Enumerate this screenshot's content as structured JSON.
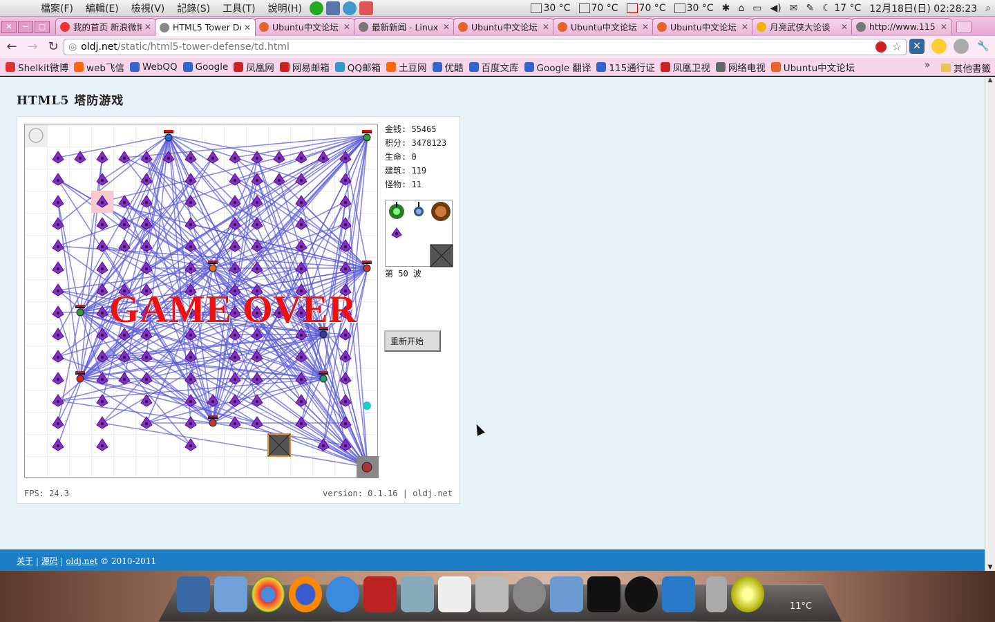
{
  "menubar": {
    "menus": [
      "檔案(F)",
      "編輯(E)",
      "檢視(V)",
      "記錄(S)",
      "工具(T)",
      "說明(H)"
    ],
    "status": {
      "temp1": "30 °C",
      "temp2": "70 °C",
      "temp3": "70 °C",
      "temp4": "30 °C",
      "weather": "17 °C",
      "clock": "12月18日(日) 02:28:23"
    }
  },
  "browser": {
    "tabs": [
      {
        "title": "我的首页 新浪微博",
        "active": false,
        "color": "#e33"
      },
      {
        "title": "HTML5 Tower De",
        "active": true,
        "color": "#888"
      },
      {
        "title": "Ubuntu中文论坛",
        "active": false,
        "color": "#e8622c"
      },
      {
        "title": "最新新闻 - Linux",
        "active": false,
        "color": "#777"
      },
      {
        "title": "Ubuntu中文论坛",
        "active": false,
        "color": "#e8622c"
      },
      {
        "title": "Ubuntu中文论坛",
        "active": false,
        "color": "#e8622c"
      },
      {
        "title": "Ubuntu中文论坛",
        "active": false,
        "color": "#e8622c"
      },
      {
        "title": "月亮武侠大论谈",
        "active": false,
        "color": "#f0b400"
      },
      {
        "title": "http://www.115",
        "active": false,
        "color": "#777"
      }
    ],
    "url_host": "oldj.net",
    "url_path": "/static/html5-tower-defense/td.html",
    "bookmarks": [
      {
        "label": "Shelkit微博",
        "color": "#d33"
      },
      {
        "label": "web飞信",
        "color": "#f60"
      },
      {
        "label": "WebQQ",
        "color": "#36c"
      },
      {
        "label": "Google",
        "color": "#36c"
      },
      {
        "label": "凤凰网",
        "color": "#c22"
      },
      {
        "label": "网易邮箱",
        "color": "#c22"
      },
      {
        "label": "QQ邮箱",
        "color": "#39c"
      },
      {
        "label": "土豆网",
        "color": "#f60"
      },
      {
        "label": "优酷",
        "color": "#36c"
      },
      {
        "label": "百度文库",
        "color": "#36c"
      },
      {
        "label": "Google 翻译",
        "color": "#36c"
      },
      {
        "label": "115通行证",
        "color": "#36c"
      },
      {
        "label": "凤凰卫视",
        "color": "#c22"
      },
      {
        "label": "网络电视",
        "color": "#666"
      },
      {
        "label": "Ubuntu中文论坛",
        "color": "#e8622c"
      }
    ],
    "other_bookmarks": "其他書籤"
  },
  "page": {
    "title": "HTML5 塔防游戏",
    "stats": {
      "money_label": "金钱:",
      "money": "55465",
      "score_label": "积分:",
      "score": "3478123",
      "life_label": "生命:",
      "life": "0",
      "buildings_label": "建筑:",
      "buildings": "119",
      "monsters_label": "怪物:",
      "monsters": "11"
    },
    "wave": "第 50 波",
    "restart": "重新开始",
    "game_over": "GAME OVER",
    "fps": "FPS: 24.3",
    "version": "version: 0.1.16 | oldj.net",
    "footer": {
      "about": "关于",
      "source": "源码",
      "site": "oldj.net",
      "copyright": "© 2010-2011"
    }
  },
  "dock": {
    "temperature": "11°C"
  }
}
